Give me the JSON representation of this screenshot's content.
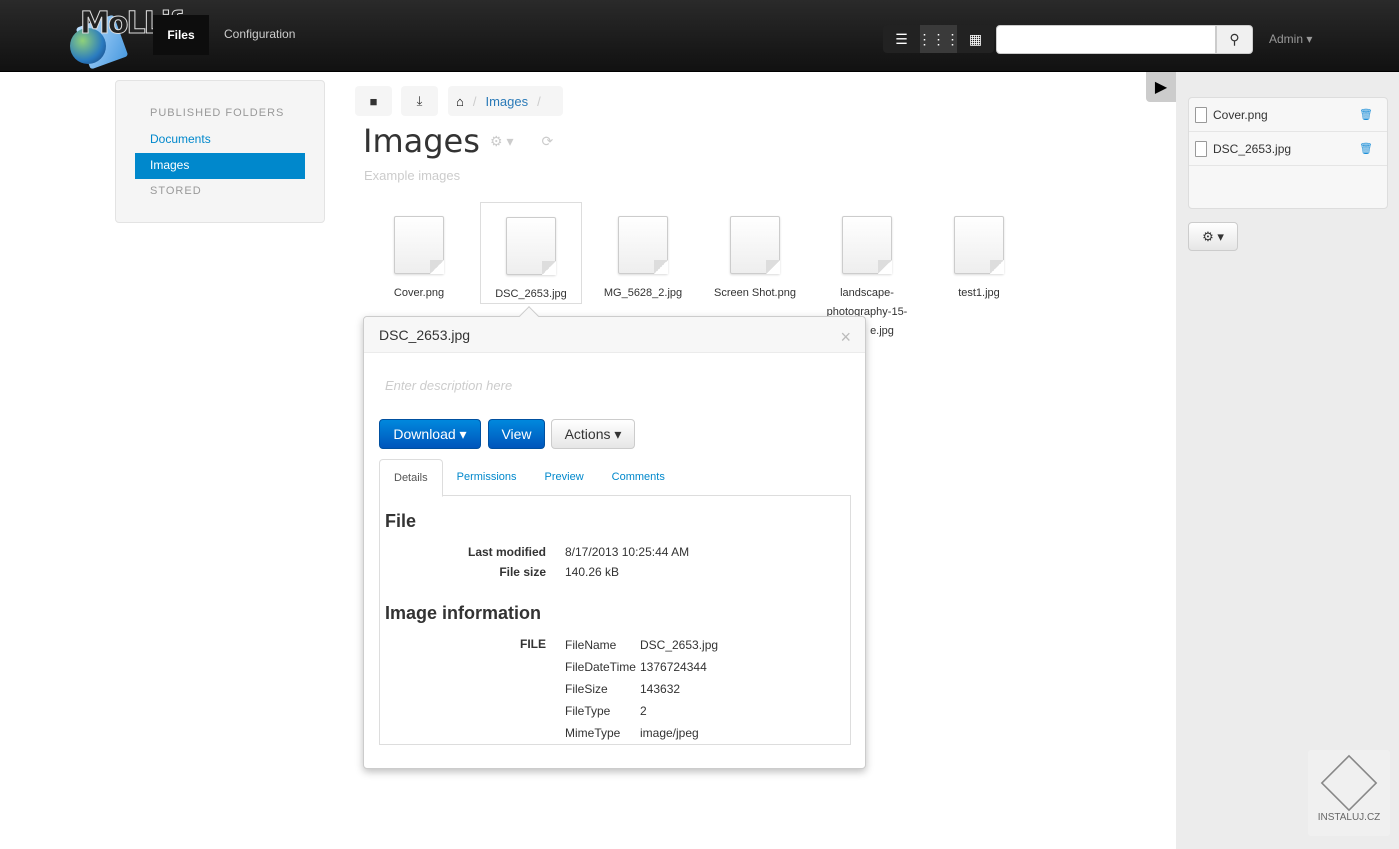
{
  "header": {
    "logo_text": "MoLLify",
    "nav": [
      {
        "label": "Files",
        "active": true
      },
      {
        "label": "Configuration",
        "active": false
      }
    ],
    "view_modes": [
      {
        "icon": "list-icon"
      },
      {
        "icon": "small-grid-icon",
        "active": true
      },
      {
        "icon": "large-grid-icon"
      }
    ],
    "search": {
      "value": "",
      "placeholder": ""
    },
    "user_menu": "Admin"
  },
  "sidebar": {
    "sections": [
      {
        "heading": "PUBLISHED FOLDERS",
        "items": [
          {
            "label": "Documents",
            "active": false
          },
          {
            "label": "Images",
            "active": true
          }
        ]
      },
      {
        "heading": "STORED",
        "items": []
      }
    ]
  },
  "main": {
    "breadcrumb": [
      "Images"
    ],
    "title": "Images",
    "description": "Example images",
    "files": [
      {
        "name": "Cover.png"
      },
      {
        "name": "DSC_2653.jpg",
        "selected": true
      },
      {
        "name": "MG_5628_2.jpg"
      },
      {
        "name": "Screen Shot.png"
      },
      {
        "name": "landscape-photography-15-...e.jpg",
        "lines": [
          "landscape-",
          "photography-15-",
          "e.jpg"
        ]
      },
      {
        "name": "test1.jpg"
      }
    ]
  },
  "popup": {
    "title": "DSC_2653.jpg",
    "close": "×",
    "description_placeholder": "Enter description here",
    "buttons": {
      "download": "Download",
      "view": "View",
      "actions": "Actions"
    },
    "tabs": [
      "Details",
      "Permissions",
      "Preview",
      "Comments"
    ],
    "active_tab": "Details",
    "file_section": {
      "heading": "File",
      "rows": [
        {
          "label": "Last modified",
          "value": "8/17/2013 10:25:44 AM"
        },
        {
          "label": "File size",
          "value": "140.26 kB"
        }
      ]
    },
    "image_section": {
      "heading": "Image information",
      "group": "FILE",
      "rows": [
        {
          "key": "FileName",
          "value": "DSC_2653.jpg"
        },
        {
          "key": "FileDateTime",
          "value": "1376724344"
        },
        {
          "key": "FileSize",
          "value": "143632"
        },
        {
          "key": "FileType",
          "value": "2"
        },
        {
          "key": "MimeType",
          "value": "image/jpeg"
        }
      ]
    }
  },
  "right_panel": {
    "items": [
      {
        "name": "Cover.png"
      },
      {
        "name": "DSC_2653.jpg"
      }
    ]
  },
  "watermark": "INSTALUJ.CZ",
  "colors": {
    "accent": "#0088cc",
    "topbar": "#1a1a1a",
    "primary_button": "#0066cc"
  }
}
